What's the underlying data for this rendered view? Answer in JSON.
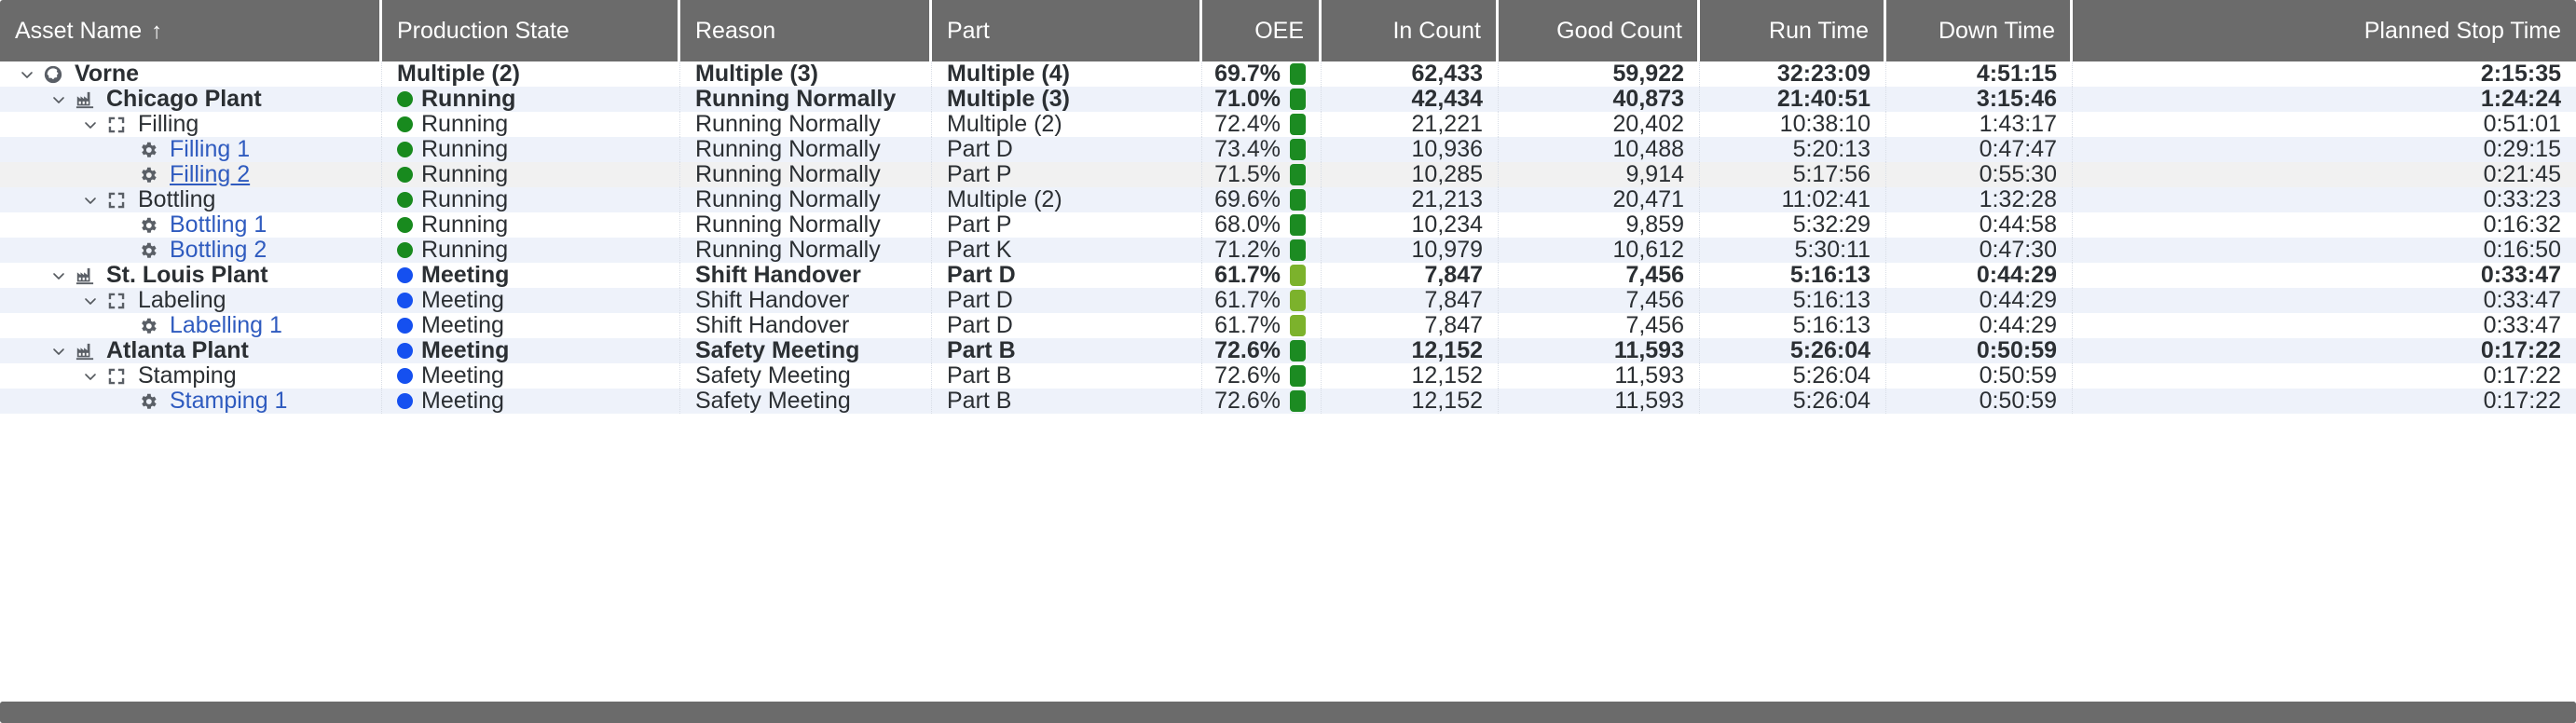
{
  "colors": {
    "header_bg": "#6b6b6b",
    "stripe_bg": "#eef2fa",
    "hover_bg": "#f1f1f1",
    "link": "#2f5bbf",
    "running_dot": "#188a1e",
    "meeting_dot": "#1550f0",
    "oee_green": "#1c8b22",
    "oee_yellow_green": "#7cb22c",
    "text": "#2b2f33"
  },
  "header": {
    "columns": [
      {
        "label": "Asset Name",
        "align": "left",
        "sort": "↑"
      },
      {
        "label": "Production State",
        "align": "left"
      },
      {
        "label": "Reason",
        "align": "left"
      },
      {
        "label": "Part",
        "align": "left"
      },
      {
        "label": "OEE",
        "align": "right"
      },
      {
        "label": "In Count",
        "align": "right"
      },
      {
        "label": "Good Count",
        "align": "right"
      },
      {
        "label": "Run Time",
        "align": "right"
      },
      {
        "label": "Down Time",
        "align": "right"
      },
      {
        "label": "Planned Stop Time",
        "align": "right"
      }
    ]
  },
  "rows": [
    {
      "indent": 0,
      "twisty": "down",
      "icon": "globe-icon",
      "name": "Vorne",
      "link": false,
      "underline": false,
      "bold": true,
      "row_style": "plain",
      "state": "Multiple (2)",
      "state_dot": null,
      "reason": "Multiple (3)",
      "part": "Multiple (4)",
      "oee": "69.7%",
      "oee_color": "#1c8b22",
      "in_count": "62,433",
      "good_count": "59,922",
      "run_time": "32:23:09",
      "down_time": "4:51:15",
      "planned_stop_time": "2:15:35"
    },
    {
      "indent": 1,
      "twisty": "down",
      "icon": "factory-icon",
      "name": "Chicago Plant",
      "link": false,
      "underline": false,
      "bold": true,
      "row_style": "stripe",
      "state": "Running",
      "state_dot": "#188a1e",
      "reason": "Running Normally",
      "part": "Multiple (3)",
      "oee": "71.0%",
      "oee_color": "#1c8b22",
      "in_count": "42,434",
      "good_count": "40,873",
      "run_time": "21:40:51",
      "down_time": "3:15:46",
      "planned_stop_time": "1:24:24"
    },
    {
      "indent": 2,
      "twisty": "down",
      "icon": "line-icon",
      "name": "Filling",
      "link": false,
      "underline": false,
      "bold": false,
      "row_style": "plain",
      "state": "Running",
      "state_dot": "#188a1e",
      "reason": "Running Normally",
      "part": "Multiple (2)",
      "oee": "72.4%",
      "oee_color": "#1c8b22",
      "in_count": "21,221",
      "good_count": "20,402",
      "run_time": "10:38:10",
      "down_time": "1:43:17",
      "planned_stop_time": "0:51:01"
    },
    {
      "indent": 3,
      "twisty": "none",
      "icon": "gear-icon",
      "name": "Filling 1",
      "link": true,
      "underline": false,
      "bold": false,
      "row_style": "stripe",
      "state": "Running",
      "state_dot": "#188a1e",
      "reason": "Running Normally",
      "part": "Part D",
      "oee": "73.4%",
      "oee_color": "#1c8b22",
      "in_count": "10,936",
      "good_count": "10,488",
      "run_time": "5:20:13",
      "down_time": "0:47:47",
      "planned_stop_time": "0:29:15"
    },
    {
      "indent": 3,
      "twisty": "none",
      "icon": "gear-icon",
      "name": "Filling 2",
      "link": true,
      "underline": true,
      "bold": false,
      "row_style": "hover",
      "state": "Running",
      "state_dot": "#188a1e",
      "reason": "Running Normally",
      "part": "Part P",
      "oee": "71.5%",
      "oee_color": "#1c8b22",
      "in_count": "10,285",
      "good_count": "9,914",
      "run_time": "5:17:56",
      "down_time": "0:55:30",
      "planned_stop_time": "0:21:45"
    },
    {
      "indent": 2,
      "twisty": "down",
      "icon": "line-icon",
      "name": "Bottling",
      "link": false,
      "underline": false,
      "bold": false,
      "row_style": "stripe",
      "state": "Running",
      "state_dot": "#188a1e",
      "reason": "Running Normally",
      "part": "Multiple (2)",
      "oee": "69.6%",
      "oee_color": "#1c8b22",
      "in_count": "21,213",
      "good_count": "20,471",
      "run_time": "11:02:41",
      "down_time": "1:32:28",
      "planned_stop_time": "0:33:23"
    },
    {
      "indent": 3,
      "twisty": "none",
      "icon": "gear-icon",
      "name": "Bottling 1",
      "link": true,
      "underline": false,
      "bold": false,
      "row_style": "plain",
      "state": "Running",
      "state_dot": "#188a1e",
      "reason": "Running Normally",
      "part": "Part P",
      "oee": "68.0%",
      "oee_color": "#1c8b22",
      "in_count": "10,234",
      "good_count": "9,859",
      "run_time": "5:32:29",
      "down_time": "0:44:58",
      "planned_stop_time": "0:16:32"
    },
    {
      "indent": 3,
      "twisty": "none",
      "icon": "gear-icon",
      "name": "Bottling 2",
      "link": true,
      "underline": false,
      "bold": false,
      "row_style": "stripe",
      "state": "Running",
      "state_dot": "#188a1e",
      "reason": "Running Normally",
      "part": "Part K",
      "oee": "71.2%",
      "oee_color": "#1c8b22",
      "in_count": "10,979",
      "good_count": "10,612",
      "run_time": "5:30:11",
      "down_time": "0:47:30",
      "planned_stop_time": "0:16:50"
    },
    {
      "indent": 1,
      "twisty": "down",
      "icon": "factory-icon",
      "name": "St. Louis Plant",
      "link": false,
      "underline": false,
      "bold": true,
      "row_style": "plain",
      "state": "Meeting",
      "state_dot": "#1550f0",
      "reason": "Shift Handover",
      "part": "Part D",
      "oee": "61.7%",
      "oee_color": "#7cb22c",
      "in_count": "7,847",
      "good_count": "7,456",
      "run_time": "5:16:13",
      "down_time": "0:44:29",
      "planned_stop_time": "0:33:47"
    },
    {
      "indent": 2,
      "twisty": "down",
      "icon": "line-icon",
      "name": "Labeling",
      "link": false,
      "underline": false,
      "bold": false,
      "row_style": "stripe",
      "state": "Meeting",
      "state_dot": "#1550f0",
      "reason": "Shift Handover",
      "part": "Part D",
      "oee": "61.7%",
      "oee_color": "#7cb22c",
      "in_count": "7,847",
      "good_count": "7,456",
      "run_time": "5:16:13",
      "down_time": "0:44:29",
      "planned_stop_time": "0:33:47"
    },
    {
      "indent": 3,
      "twisty": "none",
      "icon": "gear-icon",
      "name": "Labelling 1",
      "link": true,
      "underline": false,
      "bold": false,
      "row_style": "plain",
      "state": "Meeting",
      "state_dot": "#1550f0",
      "reason": "Shift Handover",
      "part": "Part D",
      "oee": "61.7%",
      "oee_color": "#7cb22c",
      "in_count": "7,847",
      "good_count": "7,456",
      "run_time": "5:16:13",
      "down_time": "0:44:29",
      "planned_stop_time": "0:33:47"
    },
    {
      "indent": 1,
      "twisty": "down",
      "icon": "factory-icon",
      "name": "Atlanta Plant",
      "link": false,
      "underline": false,
      "bold": true,
      "row_style": "stripe",
      "state": "Meeting",
      "state_dot": "#1550f0",
      "reason": "Safety Meeting",
      "part": "Part B",
      "oee": "72.6%",
      "oee_color": "#1c8b22",
      "in_count": "12,152",
      "good_count": "11,593",
      "run_time": "5:26:04",
      "down_time": "0:50:59",
      "planned_stop_time": "0:17:22"
    },
    {
      "indent": 2,
      "twisty": "down",
      "icon": "line-icon",
      "name": "Stamping",
      "link": false,
      "underline": false,
      "bold": false,
      "row_style": "plain",
      "state": "Meeting",
      "state_dot": "#1550f0",
      "reason": "Safety Meeting",
      "part": "Part B",
      "oee": "72.6%",
      "oee_color": "#1c8b22",
      "in_count": "12,152",
      "good_count": "11,593",
      "run_time": "5:26:04",
      "down_time": "0:50:59",
      "planned_stop_time": "0:17:22"
    },
    {
      "indent": 3,
      "twisty": "none",
      "icon": "gear-icon",
      "name": "Stamping 1",
      "link": true,
      "underline": false,
      "bold": false,
      "row_style": "stripe",
      "state": "Meeting",
      "state_dot": "#1550f0",
      "reason": "Safety Meeting",
      "part": "Part B",
      "oee": "72.6%",
      "oee_color": "#1c8b22",
      "in_count": "12,152",
      "good_count": "11,593",
      "run_time": "5:26:04",
      "down_time": "0:50:59",
      "planned_stop_time": "0:17:22"
    }
  ]
}
